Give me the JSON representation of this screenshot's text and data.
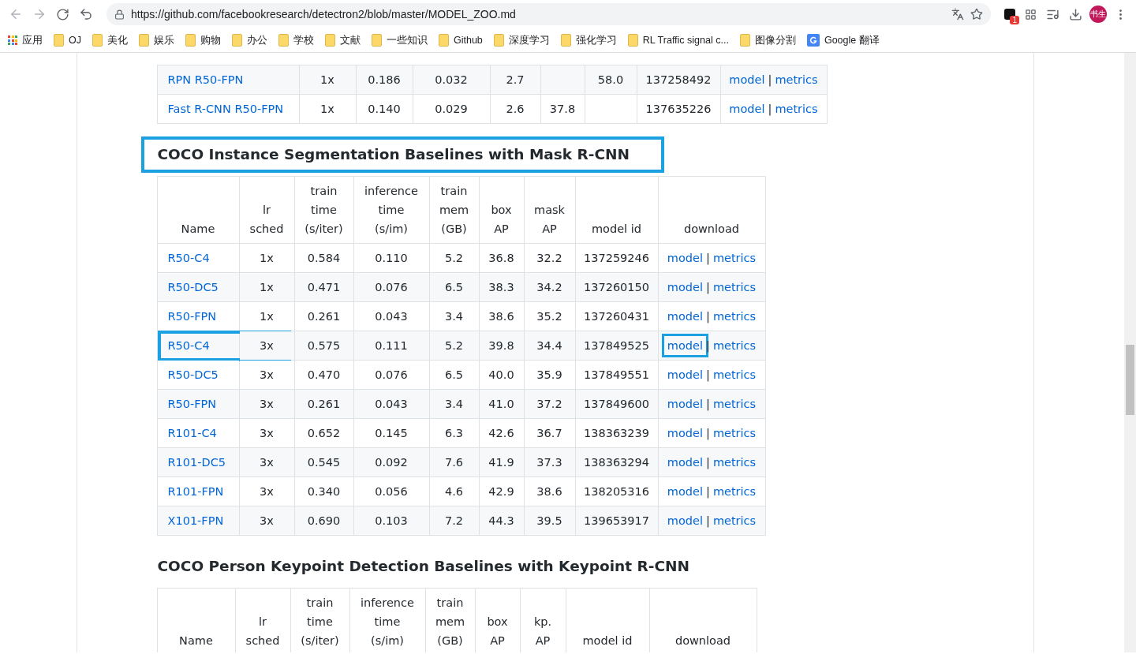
{
  "browser": {
    "url": "https://github.com/facebookresearch/detectron2/blob/master/MODEL_ZOO.md",
    "extension_badge": "1",
    "avatar": "书生",
    "bookmarks": [
      {
        "kind": "apps",
        "label": "应用"
      },
      {
        "kind": "folder",
        "label": "OJ"
      },
      {
        "kind": "folder",
        "label": "美化"
      },
      {
        "kind": "folder",
        "label": "娱乐"
      },
      {
        "kind": "folder",
        "label": "购物"
      },
      {
        "kind": "folder",
        "label": "办公"
      },
      {
        "kind": "folder",
        "label": "学校"
      },
      {
        "kind": "folder",
        "label": "文献"
      },
      {
        "kind": "folder",
        "label": "一些知识"
      },
      {
        "kind": "folder",
        "label": "Github"
      },
      {
        "kind": "folder",
        "label": "深度学习"
      },
      {
        "kind": "folder",
        "label": "强化学习"
      },
      {
        "kind": "folder",
        "label": "RL Traffic signal c..."
      },
      {
        "kind": "folder",
        "label": "图像分割"
      },
      {
        "kind": "translate",
        "label": "Google 翻译"
      }
    ]
  },
  "top_table": {
    "rows": [
      {
        "cells": [
          "RPN R50-FPN",
          "1x",
          "0.186",
          "0.032",
          "2.7",
          null,
          "58.0",
          "137258492"
        ],
        "download": [
          "model",
          "|",
          "metrics"
        ]
      },
      {
        "cells": [
          "Fast R-CNN R50-FPN",
          "1x",
          "0.140",
          "0.029",
          "2.6",
          "37.8",
          null,
          "137635226"
        ],
        "download": [
          "model",
          "|",
          "metrics"
        ]
      }
    ]
  },
  "sections": [
    {
      "heading": "COCO Instance Segmentation Baselines with Mask R-CNN",
      "highlighted": true,
      "columns": [
        "Name",
        "lr\nsched",
        "train\ntime\n(s/iter)",
        "inference\ntime\n(s/im)",
        "train\nmem\n(GB)",
        "box\nAP",
        "mask\nAP",
        "model id",
        "download"
      ],
      "rows": [
        {
          "cells": [
            "R50-C4",
            "1x",
            "0.584",
            "0.110",
            "5.2",
            "36.8",
            "32.2",
            "137259246"
          ],
          "download": [
            "model",
            "|",
            "metrics"
          ],
          "highlighted": false,
          "model_highlighted": false
        },
        {
          "cells": [
            "R50-DC5",
            "1x",
            "0.471",
            "0.076",
            "6.5",
            "38.3",
            "34.2",
            "137260150"
          ],
          "download": [
            "model",
            "|",
            "metrics"
          ],
          "highlighted": false,
          "model_highlighted": false
        },
        {
          "cells": [
            "R50-FPN",
            "1x",
            "0.261",
            "0.043",
            "3.4",
            "38.6",
            "35.2",
            "137260431"
          ],
          "download": [
            "model",
            "|",
            "metrics"
          ],
          "highlighted": false,
          "model_highlighted": false
        },
        {
          "cells": [
            "R50-C4",
            "3x",
            "0.575",
            "0.111",
            "5.2",
            "39.8",
            "34.4",
            "137849525"
          ],
          "download": [
            "model",
            "|",
            "metrics"
          ],
          "highlighted": true,
          "model_highlighted": true
        },
        {
          "cells": [
            "R50-DC5",
            "3x",
            "0.470",
            "0.076",
            "6.5",
            "40.0",
            "35.9",
            "137849551"
          ],
          "download": [
            "model",
            "|",
            "metrics"
          ],
          "highlighted": false,
          "model_highlighted": false
        },
        {
          "cells": [
            "R50-FPN",
            "3x",
            "0.261",
            "0.043",
            "3.4",
            "41.0",
            "37.2",
            "137849600"
          ],
          "download": [
            "model",
            "|",
            "metrics"
          ],
          "highlighted": false,
          "model_highlighted": false
        },
        {
          "cells": [
            "R101-C4",
            "3x",
            "0.652",
            "0.145",
            "6.3",
            "42.6",
            "36.7",
            "138363239"
          ],
          "download": [
            "model",
            "|",
            "metrics"
          ],
          "highlighted": false,
          "model_highlighted": false
        },
        {
          "cells": [
            "R101-DC5",
            "3x",
            "0.545",
            "0.092",
            "7.6",
            "41.9",
            "37.3",
            "138363294"
          ],
          "download": [
            "model",
            "|",
            "metrics"
          ],
          "highlighted": false,
          "model_highlighted": false
        },
        {
          "cells": [
            "R101-FPN",
            "3x",
            "0.340",
            "0.056",
            "4.6",
            "42.9",
            "38.6",
            "138205316"
          ],
          "download": [
            "model",
            "|",
            "metrics"
          ],
          "highlighted": false,
          "model_highlighted": false
        },
        {
          "cells": [
            "X101-FPN",
            "3x",
            "0.690",
            "0.103",
            "7.2",
            "44.3",
            "39.5",
            "139653917"
          ],
          "download": [
            "model",
            "|",
            "metrics"
          ],
          "highlighted": false,
          "model_highlighted": false
        }
      ]
    },
    {
      "heading": "COCO Person Keypoint Detection Baselines with Keypoint R-CNN",
      "highlighted": false,
      "columns": [
        "Name",
        "lr\nsched",
        "train\ntime\n(s/iter)",
        "inference\ntime\n(s/im)",
        "train\nmem\n(GB)",
        "box\nAP",
        "kp.\nAP",
        "model id",
        "download"
      ]
    }
  ]
}
